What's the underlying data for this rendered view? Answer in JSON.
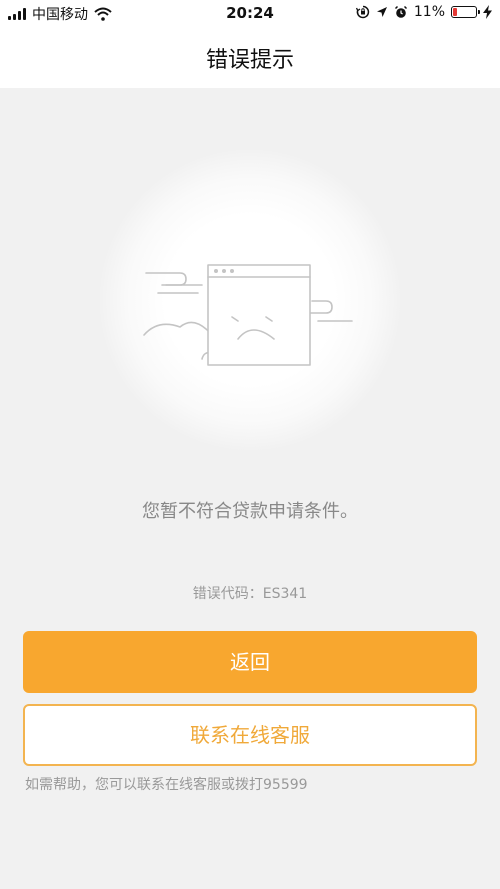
{
  "status_bar": {
    "carrier": "中国移动",
    "time": "20:24",
    "battery_percent": "11%",
    "icons": [
      "signal-icon",
      "wifi-icon",
      "orientation-lock-icon",
      "location-icon",
      "alarm-icon",
      "charging-icon",
      "battery-icon"
    ],
    "battery_color": "#e53935"
  },
  "nav": {
    "title": "错误提示"
  },
  "content": {
    "illustration_icon": "sad-browser-window-icon",
    "message": "您暂不符合贷款申请条件。",
    "error_code": "错误代码：ES341"
  },
  "actions": {
    "back_label": "返回",
    "contact_label": "联系在线客服",
    "help_text": "如需帮助，您可以联系在线客服或拨打95599"
  },
  "colors": {
    "accent": "#f8a72f",
    "background": "#f1f1f1"
  }
}
